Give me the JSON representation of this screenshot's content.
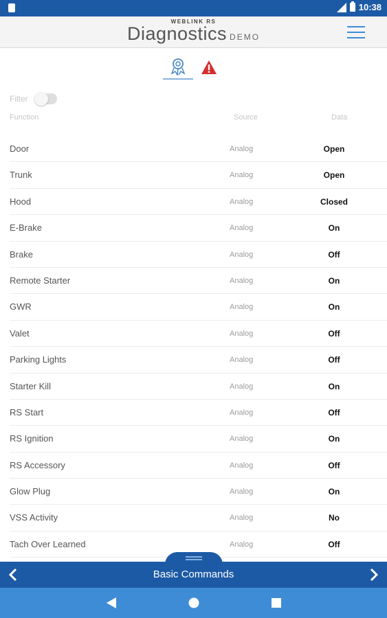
{
  "status_bar": {
    "time": "10:38",
    "icons": [
      "sim-icon",
      "signal-icon",
      "battery-icon"
    ]
  },
  "header": {
    "brand": "WEBLINK RS",
    "title": "Diagnostics",
    "mode": "DEMO",
    "menu_icon": "hamburger-icon"
  },
  "tabs": [
    {
      "icon": "diagnostics-icon",
      "active": true
    },
    {
      "icon": "warning-icon",
      "active": false
    }
  ],
  "filter": {
    "label": "Filter",
    "enabled": false
  },
  "table": {
    "headers": {
      "function": "Function",
      "source": "Source",
      "data": "Data"
    },
    "rows": [
      {
        "function": "Door",
        "source": "Analog",
        "data": "Open"
      },
      {
        "function": "Trunk",
        "source": "Analog",
        "data": "Open"
      },
      {
        "function": "Hood",
        "source": "Analog",
        "data": "Closed"
      },
      {
        "function": "E-Brake",
        "source": "Analog",
        "data": "On"
      },
      {
        "function": "Brake",
        "source": "Analog",
        "data": "Off"
      },
      {
        "function": "Remote Starter",
        "source": "Analog",
        "data": "On"
      },
      {
        "function": "GWR",
        "source": "Analog",
        "data": "On"
      },
      {
        "function": "Valet",
        "source": "Analog",
        "data": "Off"
      },
      {
        "function": "Parking Lights",
        "source": "Analog",
        "data": "Off"
      },
      {
        "function": "Starter Kill",
        "source": "Analog",
        "data": "On"
      },
      {
        "function": "RS Start",
        "source": "Analog",
        "data": "Off"
      },
      {
        "function": "RS Ignition",
        "source": "Analog",
        "data": "On"
      },
      {
        "function": "RS Accessory",
        "source": "Analog",
        "data": "Off"
      },
      {
        "function": "Glow Plug",
        "source": "Analog",
        "data": "On"
      },
      {
        "function": "VSS Activity",
        "source": "Analog",
        "data": "No"
      },
      {
        "function": "Tach Over Learned",
        "source": "Analog",
        "data": "Off"
      }
    ]
  },
  "command_bar": {
    "label": "Basic Commands",
    "prev_icon": "chevron-left-icon",
    "next_icon": "chevron-right-icon"
  },
  "nav_bar": {
    "icons": [
      "back-icon",
      "home-icon",
      "recent-apps-icon"
    ]
  },
  "colors": {
    "primary_blue": "#1c5aa6",
    "nav_blue": "#3f8cd6",
    "alert_red": "#d32f2f"
  }
}
